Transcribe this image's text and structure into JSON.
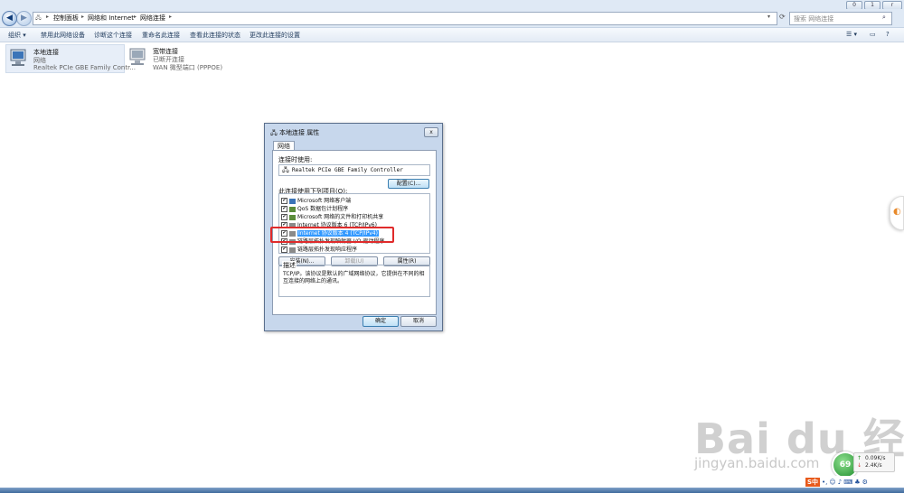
{
  "window": {
    "controls": [
      "0",
      "1",
      "r"
    ]
  },
  "address": {
    "breadcrumb": [
      "控制面板",
      "网络和 Internet",
      "网络连接"
    ],
    "search_placeholder": "搜索 网络连接"
  },
  "toolbar": {
    "items": [
      "组织 ▾",
      "禁用此网络设备",
      "诊断这个连接",
      "重命名此连接",
      "查看此连接的状态",
      "更改此连接的设置"
    ]
  },
  "connections": [
    {
      "name": "本地连接",
      "network": "网络",
      "adapter": "Realtek PCIe GBE Family Contr..."
    },
    {
      "name": "宽带连接",
      "network": "已断开连接",
      "adapter": "WAN 微型端口 (PPPOE)"
    }
  ],
  "dialog": {
    "title": "本地连接 属性",
    "close": "x",
    "tab": "网络",
    "connect_using_label": "连接时使用:",
    "adapter": "Realtek PCIe GBE Family Controller",
    "configure_button": "配置(C)...",
    "items_label": "此连接使用下列项目(O):",
    "items": [
      {
        "label": "Microsoft 网络客户端",
        "checked": true
      },
      {
        "label": "QoS 数据包计划程序",
        "checked": true
      },
      {
        "label": "Microsoft 网络的文件和打印机共享",
        "checked": true
      },
      {
        "label": "Internet 协议版本 6 (TCP/IPv6)",
        "checked": true
      },
      {
        "label": "Internet 协议版本 4 (TCP/IPv4)",
        "checked": true
      },
      {
        "label": "链路层拓扑发现映射器 I/O 驱动程序",
        "checked": true
      },
      {
        "label": "链路层拓扑发现响应程序",
        "checked": true
      }
    ],
    "install_button": "安装(N)...",
    "uninstall_button": "卸载(U)",
    "properties_button": "属性(R)",
    "description_label": "描述",
    "description_text": "TCP/IP。该协议是默认的广域网络协议，它提供在不同的相互连接的网络上的通讯。",
    "ok_button": "确定",
    "cancel_button": "取消",
    "highlight_color": "#e02b2b"
  },
  "overlay": {
    "watermark": "Bai du 经验",
    "watermark_url": "jingyan.baidu.com",
    "speed_percent": "69",
    "upload": "0.09K/s",
    "download": "2.4K/s",
    "ime_label": "S中"
  }
}
